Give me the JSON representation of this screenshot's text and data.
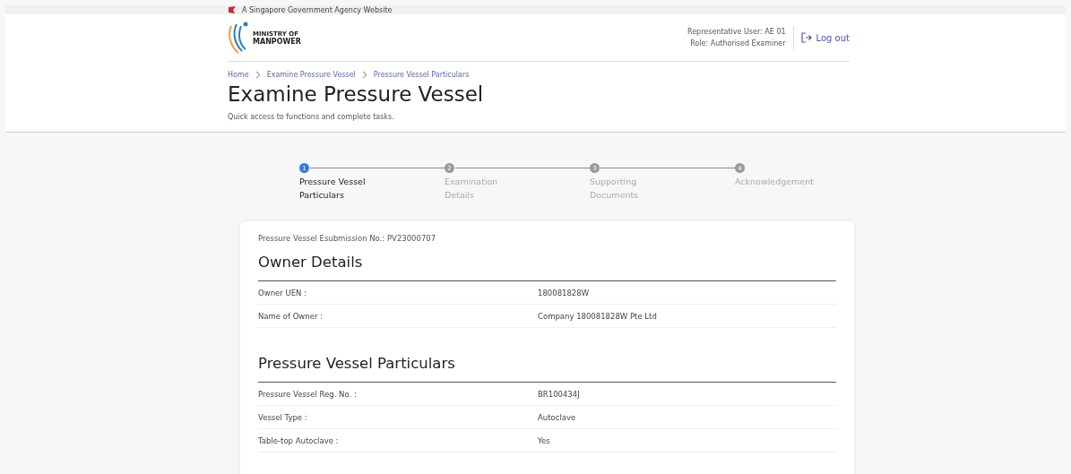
{
  "masthead": {
    "text": "A Singapore Government Agency Website"
  },
  "header": {
    "logo_line_1": "MINISTRY OF",
    "logo_line_2": "MANPOWER",
    "user": "Representative User: AE 01",
    "role": "Role: Authorised Examiner",
    "logout": "Log out"
  },
  "breadcrumbs": [
    "Home",
    "Examine Pressure Vessel",
    "Pressure Vessel Particulars"
  ],
  "page": {
    "title": "Examine Pressure Vessel",
    "subtitle": "Quick access to functions and complete tasks."
  },
  "steps": [
    {
      "number": "1",
      "label_line_1": "Pressure Vessel",
      "label_line_2": "Particulars",
      "selected": true
    },
    {
      "number": "2",
      "label_line_1": "Examination",
      "label_line_2": "Details",
      "selected": false
    },
    {
      "number": "3",
      "label_line_1": "Supporting",
      "label_line_2": "Documents",
      "selected": false
    },
    {
      "number": "4",
      "label_line_1": "Acknowledgement",
      "selected": false
    }
  ],
  "card": {
    "submission": "Pressure Vessel Esubmission No.: PV23000707",
    "sections": [
      {
        "title": "Owner Details",
        "rows": [
          {
            "label": "Owner UEN :",
            "value": "180081828W"
          },
          {
            "label": "Name of Owner :",
            "value": "Company 180081828W Pte Ltd"
          }
        ]
      },
      {
        "title": "Pressure Vessel Particulars",
        "rows": [
          {
            "label": "Pressure Vessel Reg. No. :",
            "value": "BR100434J"
          },
          {
            "label": "Vessel Type :",
            "value": "Autoclave"
          },
          {
            "label": "Table-top Autoclave :",
            "value": "Yes"
          }
        ]
      }
    ]
  }
}
